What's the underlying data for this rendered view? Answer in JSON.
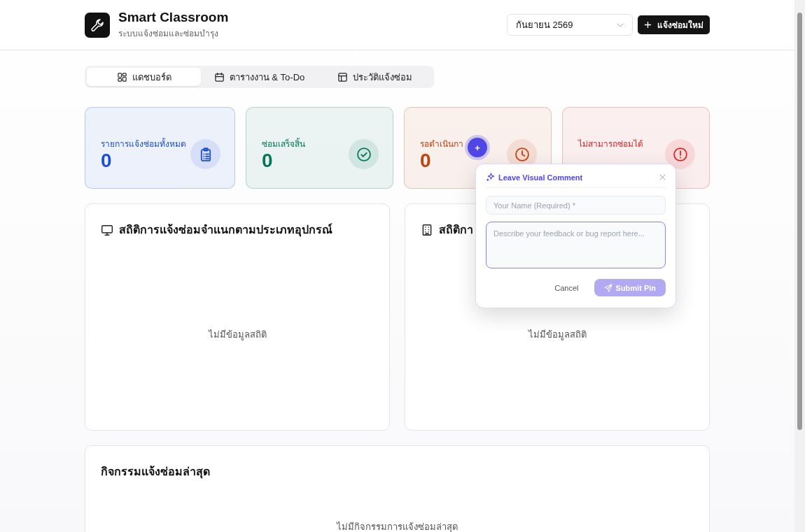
{
  "header": {
    "title": "Smart Classroom",
    "subtitle": "ระบบแจ้งซ่อมและซ่อมบำรุง",
    "month_select": {
      "value": "กันยายน 2569"
    },
    "new_button": {
      "label": "แจ้งซ่อมใหม่"
    }
  },
  "tabs": [
    {
      "label": "แดชบอร์ด",
      "kind": "dashboard",
      "selected": true
    },
    {
      "label": "ตารางงาน & To-Do",
      "kind": "calendar",
      "selected": false
    },
    {
      "label": "ประวัติแจ้งซ่อม",
      "kind": "table",
      "selected": false
    }
  ],
  "stats": [
    {
      "label": "รายการแจ้งซ่อมทั้งหมด",
      "value": "0",
      "kind": "clipboard",
      "color": "#1d4ed8"
    },
    {
      "label": "ซ่อมเสร็จสิ้น",
      "value": "0",
      "kind": "check",
      "color": "#047857"
    },
    {
      "label": "รอดำเนินกา",
      "value": "0",
      "kind": "clock",
      "color": "#c2410c"
    },
    {
      "label": "ไม่สามารถซ่อมได้",
      "kind": "alert",
      "color": "#dc2626"
    }
  ],
  "panels": [
    {
      "title": "สถิติการแจ้งซ่อมจำแนกตามประเภทอุปกรณ์",
      "kind": "monitor",
      "empty_text": "ไม่มีข้อมูลสถิติ"
    },
    {
      "title": "สถิติกา",
      "kind": "building",
      "empty_text": "ไม่มีข้อมูลสถิติ"
    }
  ],
  "activity": {
    "title": "กิจกรรมแจ้งซ่อมล่าสุด",
    "empty_text": "ไม่มีกิจกรรมการแจ้งซ่อมล่าสุด"
  },
  "comment_popup": {
    "pin_label": "+",
    "title": "Leave Visual Comment",
    "name_field": {
      "placeholder": "Your Name (Required) *"
    },
    "feedback_field": {
      "placeholder": "Describe your feedback or bug report here..."
    },
    "cancel": {
      "label": "Cancel"
    },
    "submit": {
      "label": "Submit Pin",
      "disabled": true
    }
  }
}
